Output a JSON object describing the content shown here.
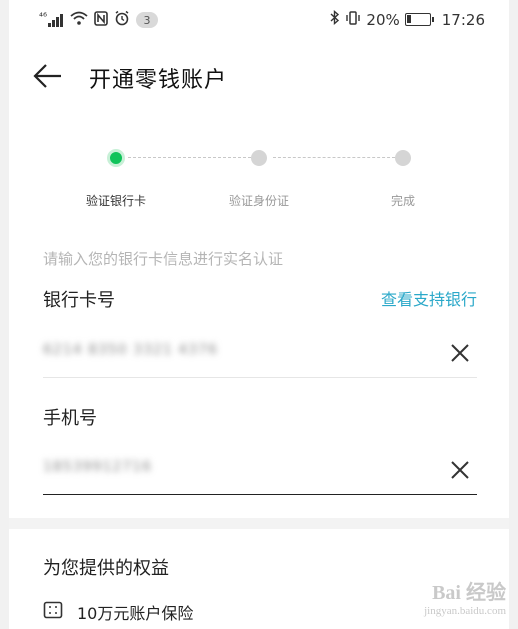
{
  "status_bar": {
    "signal_text": "⁴⁶",
    "notification_count": "3",
    "battery_percent": "20%",
    "battery_level": 0.2,
    "time": "17:26",
    "icons": [
      "signal-icon",
      "wifi-icon",
      "nfc-icon",
      "alarm-icon",
      "bluetooth-icon",
      "vibrate-icon",
      "battery-icon"
    ]
  },
  "header": {
    "title": "开通零钱账户",
    "back_icon": "arrow-left-icon"
  },
  "steps": {
    "items": [
      {
        "label": "验证银行卡",
        "active": true
      },
      {
        "label": "验证身份证",
        "active": false
      },
      {
        "label": "完成",
        "active": false
      }
    ],
    "active_color": "#10c35a"
  },
  "form": {
    "hint": "请输入您的银行卡信息进行实名认证",
    "card_label": "银行卡号",
    "support_link": "查看支持银行",
    "card_value": "6214 8350 3321 4376",
    "phone_label": "手机号",
    "phone_value": "18539912716",
    "clear_icon": "close-icon"
  },
  "benefits": {
    "title": "为您提供的权益",
    "items": [
      {
        "icon": "card-icon",
        "text": "10万元账户保险"
      }
    ]
  },
  "watermark": {
    "logo": "Bai 经验",
    "url": "jingyan.baidu.com"
  },
  "colors": {
    "link": "#2aa8c9",
    "accent": "#10c35a"
  }
}
